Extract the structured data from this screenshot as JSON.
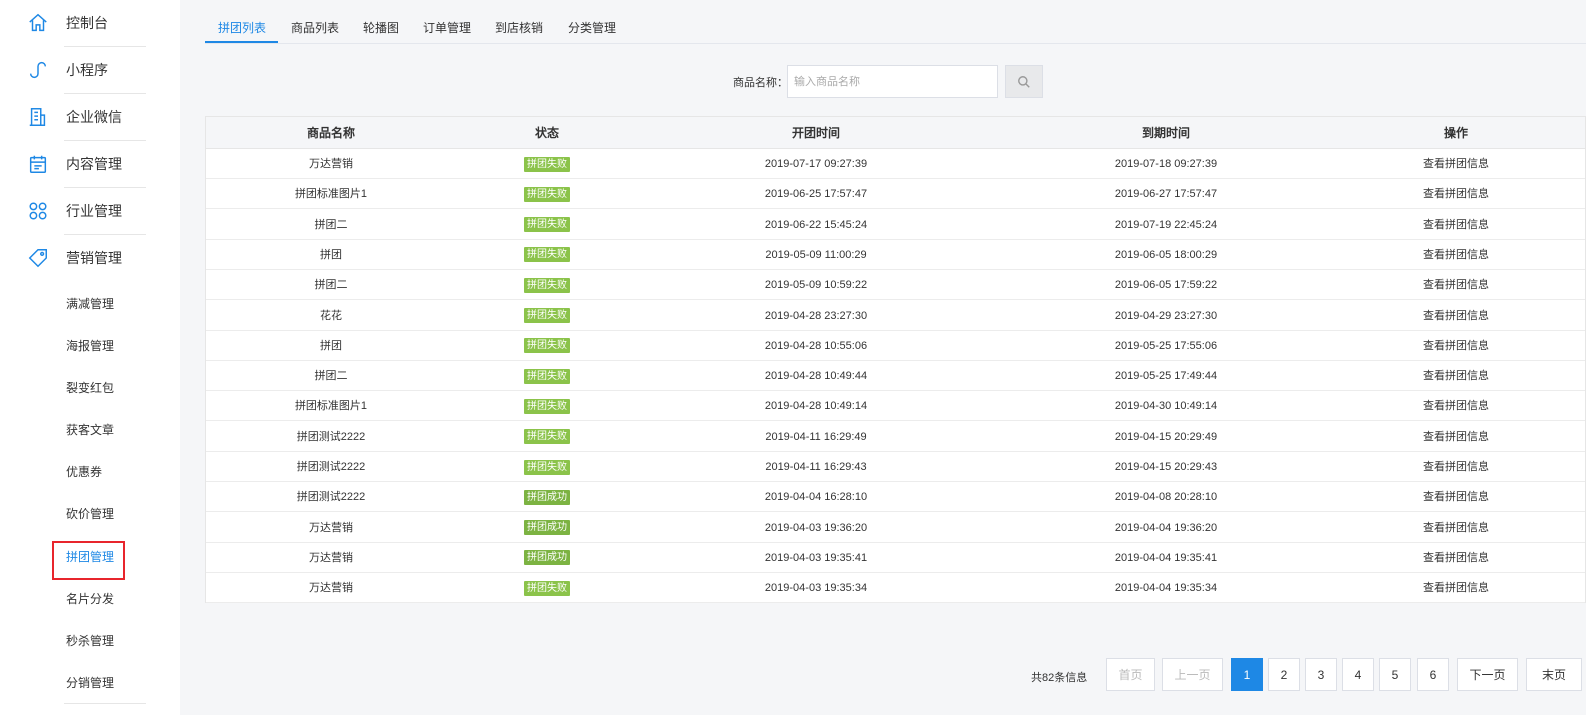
{
  "sidebar": {
    "items": [
      {
        "label": "控制台",
        "icon": "home-icon"
      },
      {
        "label": "小程序",
        "icon": "mini-program-icon"
      },
      {
        "label": "企业微信",
        "icon": "building-icon"
      },
      {
        "label": "内容管理",
        "icon": "calendar-icon"
      },
      {
        "label": "行业管理",
        "icon": "cluster-icon"
      },
      {
        "label": "营销管理",
        "icon": "tag-icon"
      }
    ],
    "sub_items": [
      "满减管理",
      "海报管理",
      "裂变红包",
      "获客文章",
      "优惠券",
      "砍价管理",
      "拼团管理",
      "名片分发",
      "秒杀管理",
      "分销管理"
    ],
    "active_sub": "拼团管理"
  },
  "tabs": [
    "拼团列表",
    "商品列表",
    "轮播图",
    "订单管理",
    "到店核销",
    "分类管理"
  ],
  "active_tab": "拼团列表",
  "search": {
    "label": "商品名称：",
    "placeholder": "输入商品名称",
    "value": ""
  },
  "table": {
    "headers": [
      "商品名称",
      "状态",
      "开团时间",
      "到期时间",
      "操作"
    ],
    "rows": [
      {
        "name": "万达营销",
        "status": "拼团失败",
        "start": "2019-07-17 09:27:39",
        "end": "2019-07-18 09:27:39",
        "action": "查看拼团信息"
      },
      {
        "name": "拼团标准图片1",
        "status": "拼团失败",
        "start": "2019-06-25 17:57:47",
        "end": "2019-06-27 17:57:47",
        "action": "查看拼团信息"
      },
      {
        "name": "拼团二",
        "status": "拼团失败",
        "start": "2019-06-22 15:45:24",
        "end": "2019-07-19 22:45:24",
        "action": "查看拼团信息"
      },
      {
        "name": "拼团",
        "status": "拼团失败",
        "start": "2019-05-09 11:00:29",
        "end": "2019-06-05 18:00:29",
        "action": "查看拼团信息"
      },
      {
        "name": "拼团二",
        "status": "拼团失败",
        "start": "2019-05-09 10:59:22",
        "end": "2019-06-05 17:59:22",
        "action": "查看拼团信息"
      },
      {
        "name": "花花",
        "status": "拼团失败",
        "start": "2019-04-28 23:27:30",
        "end": "2019-04-29 23:27:30",
        "action": "查看拼团信息"
      },
      {
        "name": "拼团",
        "status": "拼团失败",
        "start": "2019-04-28 10:55:06",
        "end": "2019-05-25 17:55:06",
        "action": "查看拼团信息"
      },
      {
        "name": "拼团二",
        "status": "拼团失败",
        "start": "2019-04-28 10:49:44",
        "end": "2019-05-25 17:49:44",
        "action": "查看拼团信息"
      },
      {
        "name": "拼团标准图片1",
        "status": "拼团失败",
        "start": "2019-04-28 10:49:14",
        "end": "2019-04-30 10:49:14",
        "action": "查看拼团信息"
      },
      {
        "name": "拼团测试2222",
        "status": "拼团失败",
        "start": "2019-04-11 16:29:49",
        "end": "2019-04-15 20:29:49",
        "action": "查看拼团信息"
      },
      {
        "name": "拼团测试2222",
        "status": "拼团失败",
        "start": "2019-04-11 16:29:43",
        "end": "2019-04-15 20:29:43",
        "action": "查看拼团信息"
      },
      {
        "name": "拼团测试2222",
        "status": "拼团成功",
        "start": "2019-04-04 16:28:10",
        "end": "2019-04-08 20:28:10",
        "action": "查看拼团信息"
      },
      {
        "name": "万达营销",
        "status": "拼团成功",
        "start": "2019-04-03 19:36:20",
        "end": "2019-04-04 19:36:20",
        "action": "查看拼团信息"
      },
      {
        "name": "万达营销",
        "status": "拼团成功",
        "start": "2019-04-03 19:35:41",
        "end": "2019-04-04 19:35:41",
        "action": "查看拼团信息"
      },
      {
        "name": "万达营销",
        "status": "拼团失败",
        "start": "2019-04-03 19:35:34",
        "end": "2019-04-04 19:35:34",
        "action": "查看拼团信息"
      }
    ]
  },
  "pagination": {
    "total_text": "共82条信息",
    "first": "首页",
    "prev": "上一页",
    "pages": [
      "1",
      "2",
      "3",
      "4",
      "5",
      "6"
    ],
    "current": "1",
    "next": "下一页",
    "last": "末页"
  },
  "colors": {
    "accent": "#1e88e5",
    "badge_fail": "#8bc34a",
    "badge_success": "#7cb342",
    "highlight_box": "#e8252c"
  }
}
